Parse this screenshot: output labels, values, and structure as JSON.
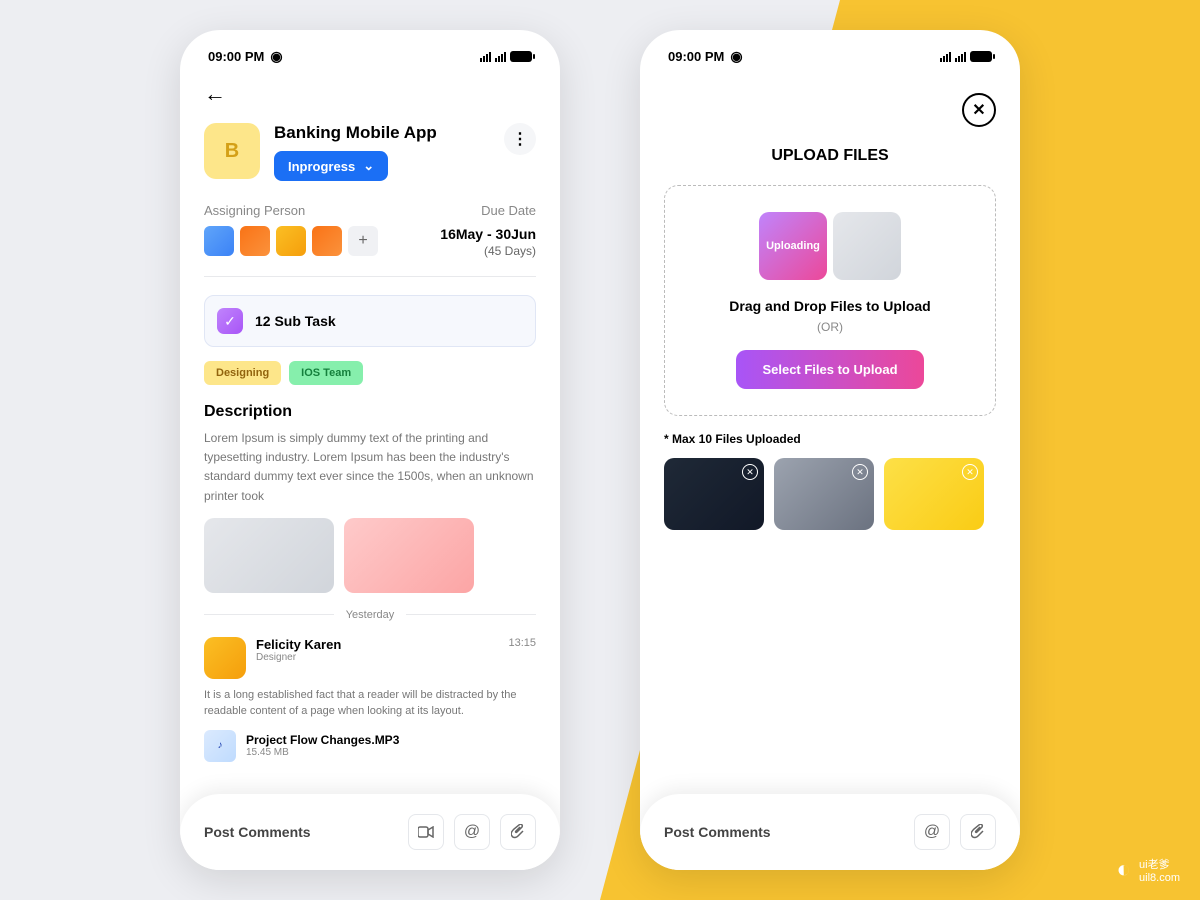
{
  "status": {
    "time": "09:00 PM"
  },
  "screen1": {
    "project_letter": "B",
    "project_title": "Banking Mobile App",
    "status_label": "Inprogress",
    "assigning_label": "Assigning Person",
    "due_label": "Due Date",
    "due_range": "16May - 30Jun",
    "due_days": "(45 Days)",
    "subtask": "12 Sub Task",
    "tags": {
      "designing": "Designing",
      "ios": "IOS Team"
    },
    "desc_title": "Description",
    "desc_text": "Lorem Ipsum is simply dummy text of the printing and typesetting industry. Lorem Ipsum has been the industry's standard dummy text ever since the 1500s, when an unknown printer took",
    "day_label": "Yesterday",
    "comment": {
      "name": "Felicity Karen",
      "role": "Designer",
      "time": "13:15",
      "text": "It is a long established fact that a reader will be distracted by the readable content of a page when looking at its layout."
    },
    "file": {
      "name": "Project Flow Changes.MP3",
      "size": "15.45 MB"
    },
    "post_placeholder": "Post Comments"
  },
  "screen2": {
    "title": "UPLOAD FILES",
    "uploading": "Uploading",
    "drop_text": "Drag and Drop Files to Upload",
    "or": "(OR)",
    "select_btn": "Select Files to Upload",
    "max_note": "* Max 10 Files Uploaded",
    "post_placeholder": "Post Comments"
  },
  "watermark": {
    "brand": "ui老爹",
    "url": "uil8.com"
  }
}
